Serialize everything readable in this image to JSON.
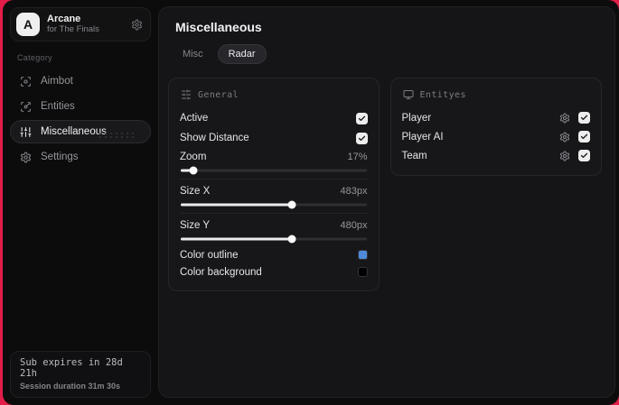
{
  "colors": {
    "frame_accent": "#e11d48",
    "outline_swatch": "#4e8ad9",
    "background_swatch": "#020202"
  },
  "sidebar": {
    "brand": {
      "logo_letter": "A",
      "title": "Arcane",
      "subtitle": "for The Finals",
      "settings_icon": "gear-icon"
    },
    "category_label": "Category",
    "items": [
      {
        "label": "Aimbot",
        "icon": "crosshair-icon",
        "active": false
      },
      {
        "label": "Entities",
        "icon": "scan-icon",
        "active": false
      },
      {
        "label": "Miscellaneous",
        "icon": "sliders-vertical-icon",
        "active": true
      },
      {
        "label": "Settings",
        "icon": "gear-icon",
        "active": false
      }
    ],
    "footer": {
      "line1": "Sub expires in 28d 21h",
      "line2": "Session duration 31m 30s"
    }
  },
  "main": {
    "title": "Miscellaneous",
    "tabs": [
      {
        "label": "Misc",
        "active": false
      },
      {
        "label": "Radar",
        "active": true
      }
    ],
    "panels": {
      "general": {
        "title": "General",
        "icon": "sliders-horizontal-icon",
        "toggles": [
          {
            "label": "Active",
            "checked": true
          },
          {
            "label": "Show Distance",
            "checked": true
          }
        ],
        "sliders": [
          {
            "label": "Zoom",
            "value": "17%",
            "percent": 7
          },
          {
            "label": "Size X",
            "value": "483px",
            "percent": 60
          },
          {
            "label": "Size Y",
            "value": "480px",
            "percent": 60
          }
        ],
        "color_rows": [
          {
            "label": "Color outline",
            "swatch": "#4e8ad9"
          },
          {
            "label": "Color background",
            "swatch": "#020202"
          }
        ]
      },
      "entities": {
        "title": "Entityes",
        "icon": "monitor-icon",
        "rows": [
          {
            "label": "Player",
            "checked": true
          },
          {
            "label": "Player AI",
            "checked": true
          },
          {
            "label": "Team",
            "checked": true
          }
        ]
      }
    }
  }
}
